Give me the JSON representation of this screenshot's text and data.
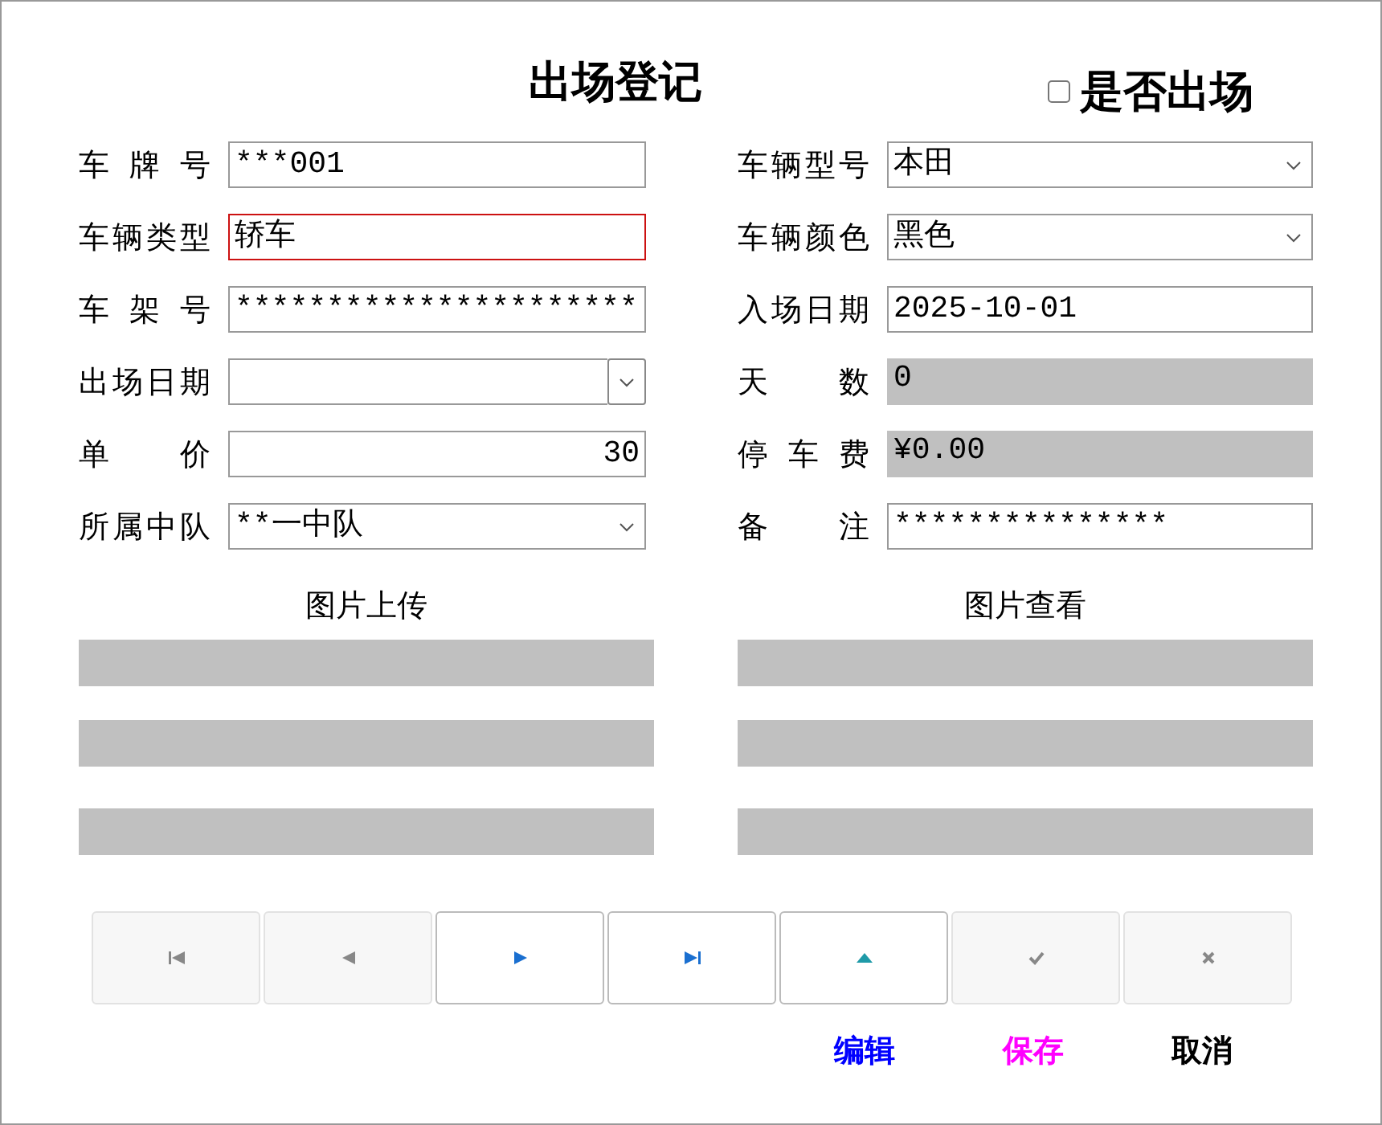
{
  "title": "出场登记",
  "exit_checkbox": {
    "label": "是否出场",
    "checked": false
  },
  "left_fields": [
    {
      "label": "车 牌 号",
      "kind": "text",
      "value": "***001",
      "highlighted": false
    },
    {
      "label": "车辆类型",
      "kind": "text",
      "value": "轿车",
      "highlighted": true
    },
    {
      "label": "车 架 号",
      "kind": "text",
      "value": "**********************",
      "highlighted": false
    },
    {
      "label": "出场日期",
      "kind": "date",
      "highlighted": false
    },
    {
      "label": "单　　价",
      "kind": "number",
      "value": "30",
      "highlighted": false
    },
    {
      "label": "所属中队",
      "kind": "select",
      "value": "**一中队",
      "highlighted": false
    }
  ],
  "right_fields": [
    {
      "label": "车辆型号",
      "kind": "select",
      "value": "本田",
      "highlighted": false
    },
    {
      "label": "车辆颜色",
      "kind": "select",
      "value": "黑色",
      "highlighted": false
    },
    {
      "label": "入场日期",
      "kind": "text",
      "value": "2025-10-01",
      "highlighted": false
    },
    {
      "label": "天　　数",
      "kind": "readonly",
      "value": "0",
      "highlighted": false
    },
    {
      "label": "停 车 费",
      "kind": "readonly",
      "value": "¥0.00",
      "highlighted": false
    },
    {
      "label": "备　　注",
      "kind": "text",
      "value": "***************",
      "highlighted": false
    }
  ],
  "picture_panels": [
    {
      "heading": "图片上传"
    },
    {
      "heading": "图片查看"
    }
  ],
  "nav_buttons": [
    {
      "kind": "first",
      "disabled": true
    },
    {
      "kind": "prev",
      "disabled": true
    },
    {
      "kind": "next",
      "disabled": false
    },
    {
      "kind": "last",
      "disabled": false
    },
    {
      "kind": "up",
      "disabled": false
    },
    {
      "kind": "check",
      "disabled": true
    },
    {
      "kind": "cancel",
      "disabled": true
    }
  ],
  "actions": [
    {
      "label": "编辑",
      "color": "#0000ff"
    },
    {
      "label": "保存",
      "color": "#ff00ff"
    },
    {
      "label": "取消",
      "color": "#000000"
    }
  ]
}
